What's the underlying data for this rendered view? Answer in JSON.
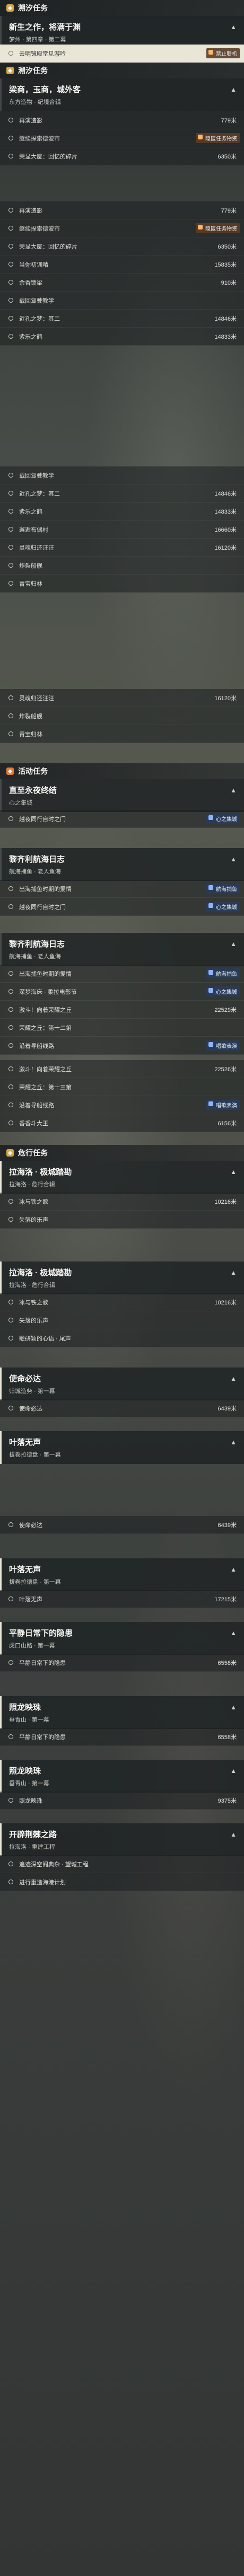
{
  "colors": {
    "accent": "#e9e5d7",
    "section_main": "#d4a64a",
    "section_event": "#e07a3a",
    "badge_blue": "#8fb4ff",
    "badge_orange": "#ffb46a"
  },
  "main_section": {
    "label": "溯汐任务"
  },
  "main_card": {
    "title": "新生之作，将满于渊",
    "sub": "梦州 · 第四章 · 第二幕"
  },
  "main_step": {
    "label": "去明镜殿堂见游吟",
    "dist": "716米",
    "badge": "禁止联机"
  },
  "side_section": {
    "label": "溯汐任务"
  },
  "sea_card": {
    "title": "梁商，玉商，城外客",
    "sub": "东方造物 · 纪境合辑"
  },
  "list1": [
    {
      "label": "再演造影",
      "dist": "779米"
    },
    {
      "label": "继续探索德波市",
      "dist": "",
      "badge": "隐匿任务物资"
    },
    {
      "label": "荣显大厦：回忆的碎片",
      "dist": "6350米"
    }
  ],
  "list2": [
    {
      "label": "再演造影",
      "dist": "779米"
    },
    {
      "label": "继续探索德波市",
      "dist": "",
      "badge": "隐匿任务物资"
    },
    {
      "label": "荣显大厦：回忆的碎片",
      "dist": "6350米"
    },
    {
      "label": "当你初训晴",
      "dist": "15835米"
    },
    {
      "label": "余香馈梁",
      "dist": "910米"
    },
    {
      "label": "载回驾驶教学",
      "dist": ""
    },
    {
      "label": "近孔之梦：其二",
      "dist": "14846米"
    },
    {
      "label": "紫乐之鹤",
      "dist": "14833米"
    }
  ],
  "list3": [
    {
      "label": "载回驾驶教学",
      "dist": ""
    },
    {
      "label": "近孔之梦：其二",
      "dist": "14846米"
    },
    {
      "label": "紫乐之鹤",
      "dist": "14833米"
    },
    {
      "label": "邂逅布偶村",
      "dist": "16660米"
    },
    {
      "label": "灵魂归还汪汪",
      "dist": "16120米"
    },
    {
      "label": "炸裂船舰",
      "dist": ""
    },
    {
      "label": "青宝归林",
      "dist": ""
    }
  ],
  "list4": [
    {
      "label": "灵魂归还汪汪",
      "dist": "16120米"
    },
    {
      "label": "炸裂船舰",
      "dist": ""
    },
    {
      "label": "青宝归林",
      "dist": ""
    }
  ],
  "event_section": {
    "label": "活动任务"
  },
  "event_card1": {
    "title": "直至永夜终结",
    "sub": "心之集城"
  },
  "event_card1_step": {
    "label": "越夜同行自时之门",
    "dist": "",
    "badge": "心之集城"
  },
  "event_card2": {
    "title": "黎齐利航海日志",
    "sub": "航海捕鱼 · 老人鱼海"
  },
  "event_card2_steps": [
    {
      "label": "出海捕鱼时期的爱情",
      "dist": "14510米",
      "badge": "航海捕鱼"
    },
    {
      "label": "越夜同行自时之门",
      "dist": "",
      "badge": "心之集城"
    }
  ],
  "event_card3": {
    "title": "黎齐利航海日志",
    "sub": "航海捕鱼 · 老人鱼海"
  },
  "event_card3_steps": [
    {
      "label": "出海捕鱼时期的爱情",
      "dist": "14510米",
      "badge": "航海捕鱼"
    },
    {
      "label": "深梦海床 · 柔拉电影节",
      "dist": "16725米",
      "badge": "心之集城"
    },
    {
      "label": "激斗！向着荣耀之丘",
      "dist": "22529米"
    },
    {
      "label": "荣耀之丘：第十二第",
      "dist": ""
    },
    {
      "label": "沿着寻船线路",
      "dist": "",
      "badge": "唱歌表演"
    }
  ],
  "event_card3b_steps": [
    {
      "label": "激斗！向着荣耀之丘",
      "dist": "22526米"
    },
    {
      "label": "荣耀之丘：第十三第",
      "dist": ""
    },
    {
      "label": "沿着寻船线路",
      "dist": "",
      "badge": "唱歌表演"
    },
    {
      "label": "香香斗大王",
      "dist": "6156米"
    }
  ],
  "quest_section": {
    "label": "危行任务"
  },
  "quest1": {
    "title": "拉海洛 · 极城踏勘",
    "sub": "拉海洛 · 危行合辑"
  },
  "quest1_steps": [
    {
      "label": "冰与铁之歌",
      "dist": "10216米"
    },
    {
      "label": "失落的乐声",
      "dist": ""
    }
  ],
  "quest2": {
    "title": "拉海洛 · 极城踏勘",
    "sub": "拉海洛 · 危行合辑"
  },
  "quest2_steps": [
    {
      "label": "冰与铁之歌",
      "dist": "10216米"
    },
    {
      "label": "失落的乐声",
      "dist": ""
    },
    {
      "label": "瞻研颖的心语 · 尾声",
      "dist": ""
    }
  ],
  "quest3": {
    "title": "使命必达",
    "sub": "归城造务 · 第一幕"
  },
  "quest3_steps": [
    {
      "label": "使命必达",
      "dist": "6439米"
    }
  ],
  "quest4": {
    "title": "叶落无声",
    "sub": "拔卷拉德盘 · 第一幕"
  },
  "quest4_steps": [
    {
      "label": "使命必达",
      "dist": "6439米"
    }
  ],
  "quest5": {
    "title": "叶落无声",
    "sub": "拔卷拉德盘 · 第一幕"
  },
  "quest5_steps": [
    {
      "label": "叶落无声",
      "dist": "17215米"
    }
  ],
  "quest6": {
    "title": "平静日常下的隐患",
    "sub": "虎口山路 · 第一幕"
  },
  "quest6_steps": [
    {
      "label": "平静日常下的隐患",
      "dist": "6558米"
    }
  ],
  "quest7": {
    "title": "照龙映珠",
    "sub": "垂青山 · 第一幕"
  },
  "quest7_steps": [
    {
      "label": "平静日常下的隐患",
      "dist": "6558米"
    }
  ],
  "quest8": {
    "title": "照龙映珠",
    "sub": "垂青山 · 第一幕"
  },
  "quest8_steps": [
    {
      "label": "照龙映珠",
      "dist": "9375米"
    }
  ],
  "quest9": {
    "title": "开辟荆棘之路",
    "sub": "拉海洛 · 重建工程"
  },
  "quest9_steps": [
    {
      "label": "追迹深空阁典杂 · 望城工程",
      "dist": ""
    },
    {
      "label": "进行重造海港计划",
      "dist": ""
    }
  ]
}
